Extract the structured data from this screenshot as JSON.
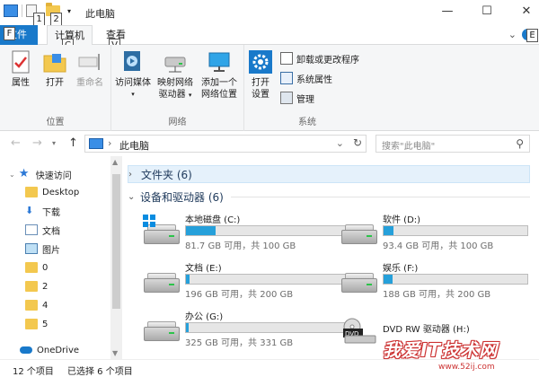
{
  "window": {
    "title": "此电脑",
    "minimize": "—",
    "maximize": "☐",
    "close": "✕",
    "keytips": {
      "file": "F",
      "computer": "C",
      "view": "V",
      "qat1": "1",
      "qat2": "2",
      "help": "E"
    }
  },
  "ribbon_tabs": {
    "file": "文件",
    "computer": "计算机",
    "view": "查看"
  },
  "ribbon": {
    "location": {
      "label": "位置",
      "properties": "属性",
      "open": "打开",
      "rename": "重命名"
    },
    "network": {
      "label": "网络",
      "access_media": "访问媒体",
      "map_drive_1": "映射网络",
      "map_drive_2": "驱动器",
      "add_location_1": "添加一个",
      "add_location_2": "网络位置"
    },
    "system": {
      "label": "系统",
      "open_settings_1": "打开",
      "open_settings_2": "设置",
      "uninstall": "卸载或更改程序",
      "system_properties": "系统属性",
      "manage": "管理"
    }
  },
  "address": {
    "path": "此电脑",
    "search_placeholder": "搜索\"此电脑\""
  },
  "nav": {
    "quick_access": "快速访问",
    "items": [
      {
        "label": "Desktop",
        "pinned": true
      },
      {
        "label": "下载",
        "pinned": true
      },
      {
        "label": "文档",
        "pinned": true
      },
      {
        "label": "图片",
        "pinned": true
      },
      {
        "label": "0",
        "pinned": false
      },
      {
        "label": "2",
        "pinned": false
      },
      {
        "label": "4",
        "pinned": false
      },
      {
        "label": "5",
        "pinned": false
      }
    ],
    "onedrive": "OneDrive"
  },
  "content": {
    "folders_header": "文件夹 (6)",
    "drives_header": "设备和驱动器 (6)",
    "drives": [
      {
        "name": "本地磁盘 (C:)",
        "free": "81.7 GB 可用，共 100 GB",
        "used_fraction": 0.183,
        "type": "windows"
      },
      {
        "name": "软件 (D:)",
        "free": "93.4 GB 可用，共 100 GB",
        "used_fraction": 0.066,
        "type": "hdd"
      },
      {
        "name": "文档 (E:)",
        "free": "196 GB 可用，共 200 GB",
        "used_fraction": 0.02,
        "type": "hdd"
      },
      {
        "name": "娱乐 (F:)",
        "free": "188 GB 可用，共 200 GB",
        "used_fraction": 0.06,
        "type": "hdd"
      },
      {
        "name": "办公 (G:)",
        "free": "325 GB 可用，共 331 GB",
        "used_fraction": 0.018,
        "type": "hdd"
      },
      {
        "name": "DVD RW 驱动器 (H:)",
        "free": "",
        "used_fraction": null,
        "type": "dvd"
      }
    ]
  },
  "status": {
    "count": "12 个项目",
    "selected": "已选择 6 个项目"
  },
  "watermark": {
    "text": "我爱IT技术网",
    "url": "www.52ij.com"
  },
  "colors": {
    "accent": "#1979ca",
    "drive_fill": "#26a0da",
    "folder": "#f3c84f"
  }
}
